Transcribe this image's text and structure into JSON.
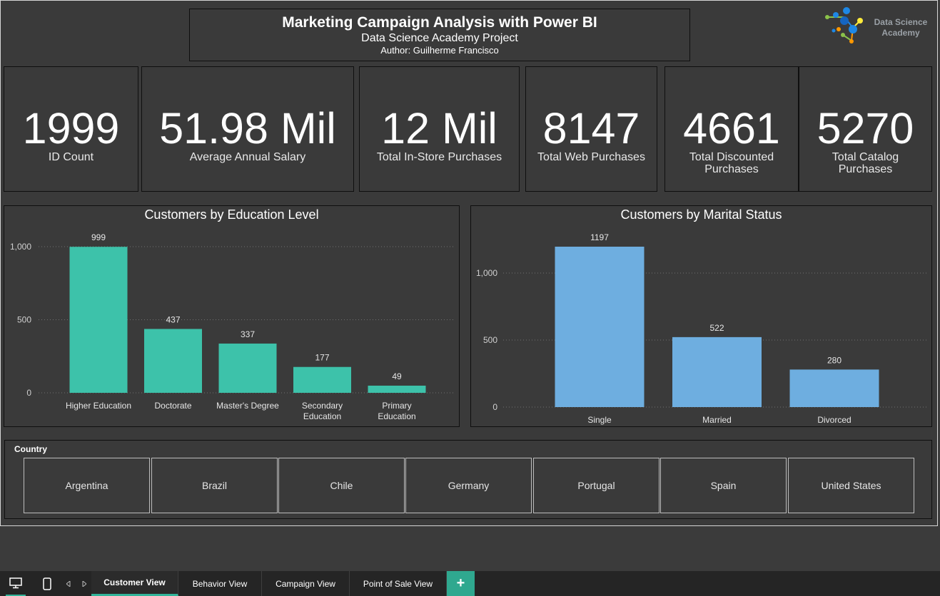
{
  "header": {
    "title": "Marketing Campaign Analysis with Power BI",
    "subtitle": "Data Science Academy Project",
    "author": "Author: Guilherme Francisco"
  },
  "logo": {
    "line1": "Data Science",
    "line2": "Academy"
  },
  "kpis": [
    {
      "value": "1999",
      "label": "ID Count"
    },
    {
      "value": "51.98 Mil",
      "label": "Average Annual Salary"
    },
    {
      "value": "12 Mil",
      "label": "Total In-Store Purchases"
    },
    {
      "value": "8147",
      "label": "Total Web Purchases"
    },
    {
      "value": "4661",
      "label": "Total Discounted Purchases"
    },
    {
      "value": "5270",
      "label": "Total Catalog Purchases"
    }
  ],
  "chart_data": [
    {
      "type": "bar",
      "title": "Customers by Education Level",
      "categories": [
        "Higher Education",
        "Doctorate",
        "Master's Degree",
        "Secondary Education",
        "Primary Education"
      ],
      "category_lines": [
        [
          "Higher Education"
        ],
        [
          "Doctorate"
        ],
        [
          "Master's Degree"
        ],
        [
          "Secondary",
          "Education"
        ],
        [
          "Primary",
          "Education"
        ]
      ],
      "values": [
        999,
        437,
        337,
        177,
        49
      ],
      "yticks": [
        0,
        500,
        1000
      ],
      "ytick_labels": [
        "0",
        "500",
        "1,000"
      ],
      "ylim": [
        0,
        1000
      ],
      "color": "#3dc2aa",
      "grid": true
    },
    {
      "type": "bar",
      "title": "Customers by Marital Status",
      "categories": [
        "Single",
        "Married",
        "Divorced"
      ],
      "category_lines": [
        [
          "Single"
        ],
        [
          "Married"
        ],
        [
          "Divorced"
        ]
      ],
      "values": [
        1197,
        522,
        280
      ],
      "yticks": [
        0,
        500,
        1000
      ],
      "ytick_labels": [
        "0",
        "500",
        "1,000"
      ],
      "ylim": [
        0,
        1197
      ],
      "color": "#6eaee0",
      "grid": true
    }
  ],
  "slicer": {
    "title": "Country",
    "options": [
      "Argentina",
      "Brazil",
      "Chile",
      "Germany",
      "Portugal",
      "Spain",
      "United States"
    ]
  },
  "tabs": [
    {
      "label": "Customer View",
      "active": true
    },
    {
      "label": "Behavior View",
      "active": false
    },
    {
      "label": "Campaign View",
      "active": false
    },
    {
      "label": "Point of Sale View",
      "active": false
    }
  ],
  "tab_add_label": "+"
}
